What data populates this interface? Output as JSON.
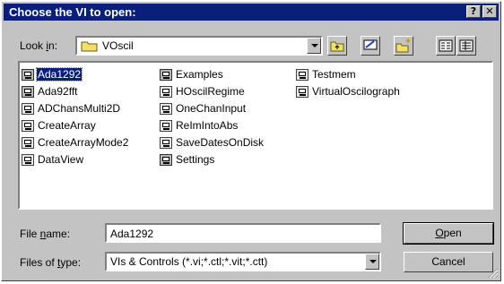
{
  "window": {
    "title": "Choose the VI to open:",
    "help_btn": "?",
    "close_btn": "✕"
  },
  "lookin": {
    "label_prefix": "Look ",
    "label_underline": "i",
    "label_suffix": "n:",
    "folder": "VOscil"
  },
  "toolbar": [
    "up-folder-icon",
    "desktop-icon",
    "new-folder-icon",
    "list-view-icon",
    "details-view-icon"
  ],
  "files": {
    "col1": [
      {
        "name": "Ada1292",
        "selected": true
      },
      {
        "name": "Ada92fft"
      },
      {
        "name": "ADChansMulti2D"
      },
      {
        "name": "CreateArray"
      },
      {
        "name": "CreateArrayMode2"
      },
      {
        "name": "DataView"
      }
    ],
    "col2": [
      {
        "name": "Examples"
      },
      {
        "name": "HOscilRegime"
      },
      {
        "name": "OneChanInput"
      },
      {
        "name": "ReImIntoAbs"
      },
      {
        "name": "SaveDatesOnDisk"
      },
      {
        "name": "Settings"
      }
    ],
    "col3": [
      {
        "name": "Testmem"
      },
      {
        "name": "VirtualOscilograph"
      }
    ]
  },
  "filename": {
    "label_prefix": "File ",
    "label_underline": "n",
    "label_suffix": "ame:",
    "value": "Ada1292"
  },
  "filetype": {
    "label_prefix": "Files of ",
    "label_underline": "t",
    "label_suffix": "ype:",
    "value": "VIs & Controls (*.vi;*.ctl;*.vit;*.ctt)"
  },
  "buttons": {
    "open_underline": "O",
    "open_rest": "pen",
    "cancel": "Cancel"
  }
}
